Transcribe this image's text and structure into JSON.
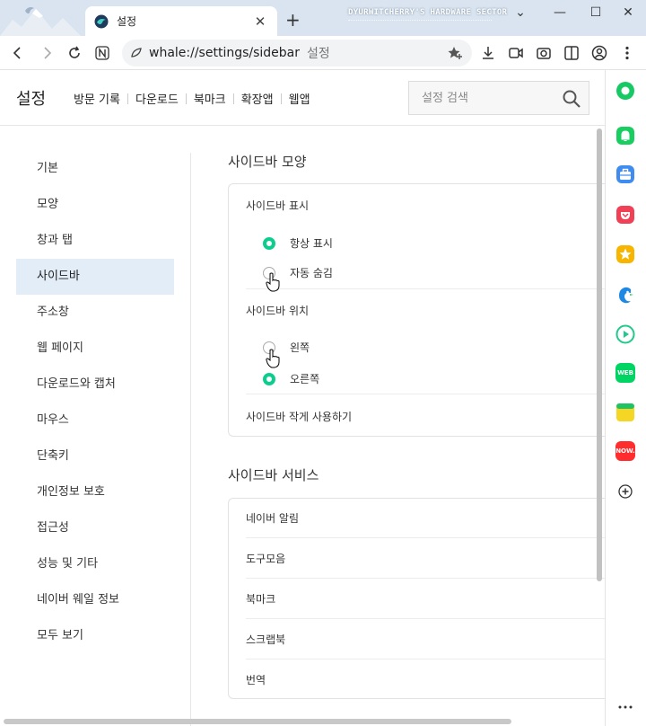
{
  "window": {
    "tab_title": "설정",
    "tab_close": "✕",
    "new_tab": "+",
    "watermark": "DYURWITCHERRY'S HARDWARE SECTOR",
    "controls": [
      "⌄",
      "—",
      "☐",
      "✕"
    ]
  },
  "toolbar": {
    "url": "whale://settings/sidebar",
    "url_title": "설정"
  },
  "header": {
    "title": "설정",
    "nav": [
      "방문 기록",
      "다운로드",
      "북마크",
      "확장앱",
      "웹앱"
    ],
    "search_placeholder": "설정 검색"
  },
  "left_nav": {
    "active_index": 3,
    "items": [
      "기본",
      "모양",
      "창과 탭",
      "사이드바",
      "주소창",
      "웹 페이지",
      "다운로드와 캡처",
      "마우스",
      "단축키",
      "개인정보 보호",
      "접근성",
      "성능 및 기타",
      "네이버 웨일 정보",
      "모두 보기"
    ]
  },
  "sidebar_appearance": {
    "title": "사이드바 모양",
    "display": {
      "label": "사이드바 표시",
      "options": [
        {
          "label": "항상 표시",
          "selected": true
        },
        {
          "label": "자동 숨김",
          "selected": false
        }
      ]
    },
    "position": {
      "label": "사이드바 위치",
      "options": [
        {
          "label": "왼쪽",
          "selected": false
        },
        {
          "label": "오른쪽",
          "selected": true
        }
      ]
    },
    "compact_label": "사이드바 작게 사용하기"
  },
  "sidebar_services": {
    "title": "사이드바 서비스",
    "items": [
      "네이버 알림",
      "도구모음",
      "북마크",
      "스크랩북",
      "번역"
    ]
  },
  "right_sidebar": {
    "accent": "#0bce8e",
    "apps": [
      {
        "name": "naver-green",
        "color": "#17c964"
      },
      {
        "name": "notification",
        "color": "#19ce60"
      },
      {
        "name": "toolbox",
        "color": "#3f8cf0"
      },
      {
        "name": "pocket",
        "color": "#ef4056"
      },
      {
        "name": "favorites-star",
        "color": "#f7b500"
      },
      {
        "name": "edge-bird",
        "color": "#1e88e5"
      },
      {
        "name": "media-play",
        "color": "#22c98a"
      },
      {
        "name": "webtoon",
        "glyph": "WEB",
        "color": "#00d564"
      },
      {
        "name": "memo",
        "color": "#f5d624"
      },
      {
        "name": "now",
        "glyph": "NOW.",
        "color": "#ff2d2d"
      }
    ],
    "add": "+",
    "more": "⋯"
  }
}
